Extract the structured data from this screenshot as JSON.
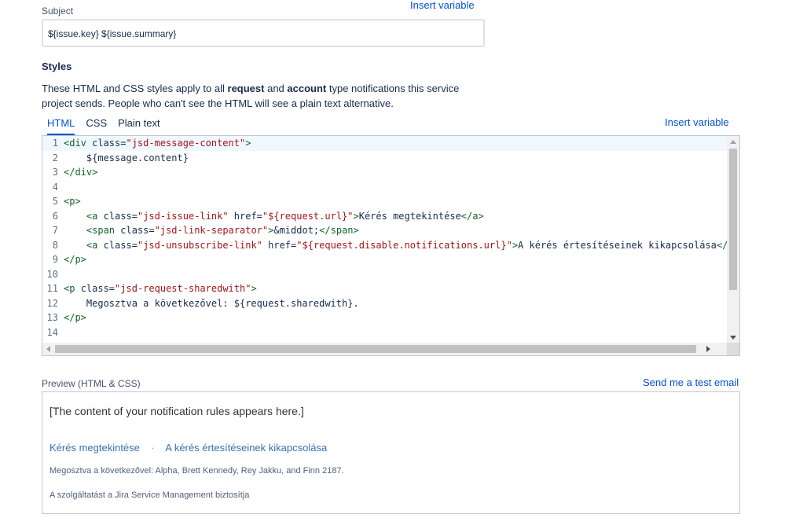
{
  "subject": {
    "label": "Subject",
    "insert_variable": "Insert variable",
    "value": "${issue.key} ${issue.summary}"
  },
  "styles": {
    "heading": "Styles",
    "desc_part1": "These HTML and CSS styles apply to all ",
    "desc_bold1": "request",
    "desc_part2": " and ",
    "desc_bold2": "account",
    "desc_part3": " type notifications this service project sends. People who can't see the HTML will see a plain text alternative.",
    "insert_variable": "Insert variable",
    "tabs": [
      {
        "label": "HTML"
      },
      {
        "label": "CSS"
      },
      {
        "label": "Plain text"
      }
    ]
  },
  "editor": {
    "lines": [
      {
        "n": "1",
        "tokens": [
          [
            "tag",
            "<div "
          ],
          [
            "attr",
            "class="
          ],
          [
            "str",
            "\"jsd-message-content\""
          ],
          [
            "tag",
            ">"
          ]
        ]
      },
      {
        "n": "2",
        "tokens": [
          [
            "text",
            "    ${message.content}"
          ]
        ]
      },
      {
        "n": "3",
        "tokens": [
          [
            "tag",
            "</div>"
          ]
        ]
      },
      {
        "n": "4",
        "tokens": [
          [
            "text",
            ""
          ]
        ]
      },
      {
        "n": "5",
        "tokens": [
          [
            "tag",
            "<p>"
          ]
        ]
      },
      {
        "n": "6",
        "tokens": [
          [
            "text",
            "    "
          ],
          [
            "tag",
            "<a "
          ],
          [
            "attr",
            "class="
          ],
          [
            "str",
            "\"jsd-issue-link\""
          ],
          [
            "attr",
            " href="
          ],
          [
            "str",
            "\"${request.url}\""
          ],
          [
            "tag",
            ">"
          ],
          [
            "text",
            "Kérés megtekintése"
          ],
          [
            "tag",
            "</a>"
          ]
        ]
      },
      {
        "n": "7",
        "tokens": [
          [
            "text",
            "    "
          ],
          [
            "tag",
            "<span "
          ],
          [
            "attr",
            "class="
          ],
          [
            "str",
            "\"jsd-link-separator\""
          ],
          [
            "tag",
            ">"
          ],
          [
            "text",
            "&middot;"
          ],
          [
            "tag",
            "</span>"
          ]
        ]
      },
      {
        "n": "8",
        "tokens": [
          [
            "text",
            "    "
          ],
          [
            "tag",
            "<a "
          ],
          [
            "attr",
            "class="
          ],
          [
            "str",
            "\"jsd-unsubscribe-link\""
          ],
          [
            "attr",
            " href="
          ],
          [
            "str",
            "\"${request.disable.notifications.url}\""
          ],
          [
            "tag",
            ">"
          ],
          [
            "text",
            "A kérés értesítéseinek kikapcsolása"
          ],
          [
            "tag",
            "</a>"
          ]
        ]
      },
      {
        "n": "9",
        "tokens": [
          [
            "tag",
            "</p>"
          ]
        ]
      },
      {
        "n": "10",
        "tokens": [
          [
            "text",
            ""
          ]
        ]
      },
      {
        "n": "11",
        "tokens": [
          [
            "tag",
            "<p "
          ],
          [
            "attr",
            "class="
          ],
          [
            "str",
            "\"jsd-request-sharedwith\""
          ],
          [
            "tag",
            ">"
          ]
        ]
      },
      {
        "n": "12",
        "tokens": [
          [
            "text",
            "    Megosztva a következővel: ${request.sharedwith}."
          ]
        ]
      },
      {
        "n": "13",
        "tokens": [
          [
            "tag",
            "</p>"
          ]
        ]
      },
      {
        "n": "14",
        "tokens": [
          [
            "text",
            ""
          ]
        ]
      }
    ]
  },
  "preview": {
    "label": "Preview (HTML & CSS)",
    "send_test": "Send me a test email",
    "content": "[The content of your notification rules appears here.]",
    "link_view": "Kérés megtekintése",
    "separator": "·",
    "link_unsubscribe": "A kérés értesítéseinek kikapcsolása",
    "shared_with": "Megosztva a következővel: Alpha, Brett Kennedy, Rey Jakku, and Finn 2187.",
    "powered_by": "A szolgáltatást a Jira Service Management biztosítja"
  }
}
